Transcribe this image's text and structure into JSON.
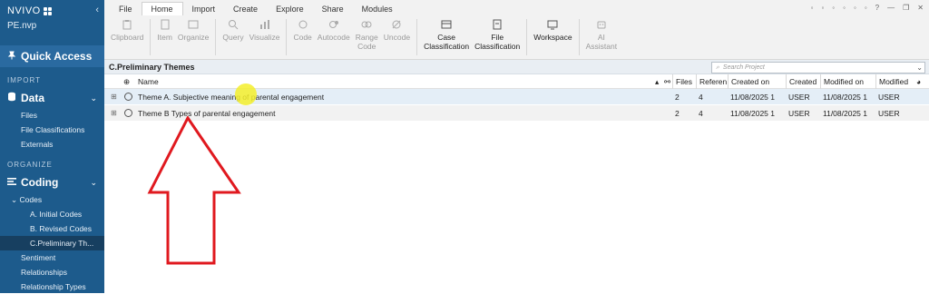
{
  "app": {
    "logo": "NVIVO",
    "project_file": "PE.nvp",
    "collapse_glyph": "‹"
  },
  "sidebar": {
    "quick_access": "Quick Access",
    "sections": {
      "import": "IMPORT",
      "organize": "ORGANIZE"
    },
    "data_group": "Data",
    "data_items": [
      "Files",
      "File Classifications",
      "Externals"
    ],
    "coding_group": "Coding",
    "codes_label": "Codes",
    "code_items": [
      "A. Initial Codes",
      "B. Revised Codes",
      "C.Preliminary Th..."
    ],
    "coding_items": [
      "Sentiment",
      "Relationships",
      "Relationship Types"
    ]
  },
  "ribbon": {
    "tabs": [
      "File",
      "Home",
      "Import",
      "Create",
      "Explore",
      "Share",
      "Modules"
    ],
    "active_tab": "Home",
    "tools": {
      "clipboard": "Clipboard",
      "item": "Item",
      "organize": "Organize",
      "query": "Query",
      "visualize": "Visualize",
      "code": "Code",
      "autocode": "Autocode",
      "range_code_1": "Range",
      "range_code_2": "Code",
      "uncode": "Uncode",
      "case_class_1": "Case",
      "case_class_2": "Classification",
      "file_class_1": "File",
      "file_class_2": "Classification",
      "workspace": "Workspace",
      "ai_1": "AI",
      "ai_2": "Assistant"
    }
  },
  "content": {
    "title": "C.Preliminary Themes",
    "search_placeholder": "Search Project",
    "columns": {
      "name": "Name",
      "files": "Files",
      "references": "Referen",
      "created_on": "Created on",
      "created_by": "Created",
      "modified_on": "Modified on",
      "modified_by": "Modified"
    },
    "rows": [
      {
        "name": "Theme A. Subjective meaning of parental engagement",
        "files": "2",
        "references": "4",
        "created_on": "11/08/2025 1",
        "created_by": "USER",
        "modified_on": "11/08/2025 1",
        "modified_by": "USER"
      },
      {
        "name": "Theme B Types of parental engagement",
        "files": "2",
        "references": "4",
        "created_on": "11/08/2025 1",
        "created_by": "USER",
        "modified_on": "11/08/2025 1",
        "modified_by": "USER"
      }
    ]
  },
  "colors": {
    "sidebar_bg": "#1d5b8c",
    "selected_row": "#e4eef7",
    "arrow_red": "#e0191f",
    "cursor_highlight": "#f4ee2b"
  }
}
